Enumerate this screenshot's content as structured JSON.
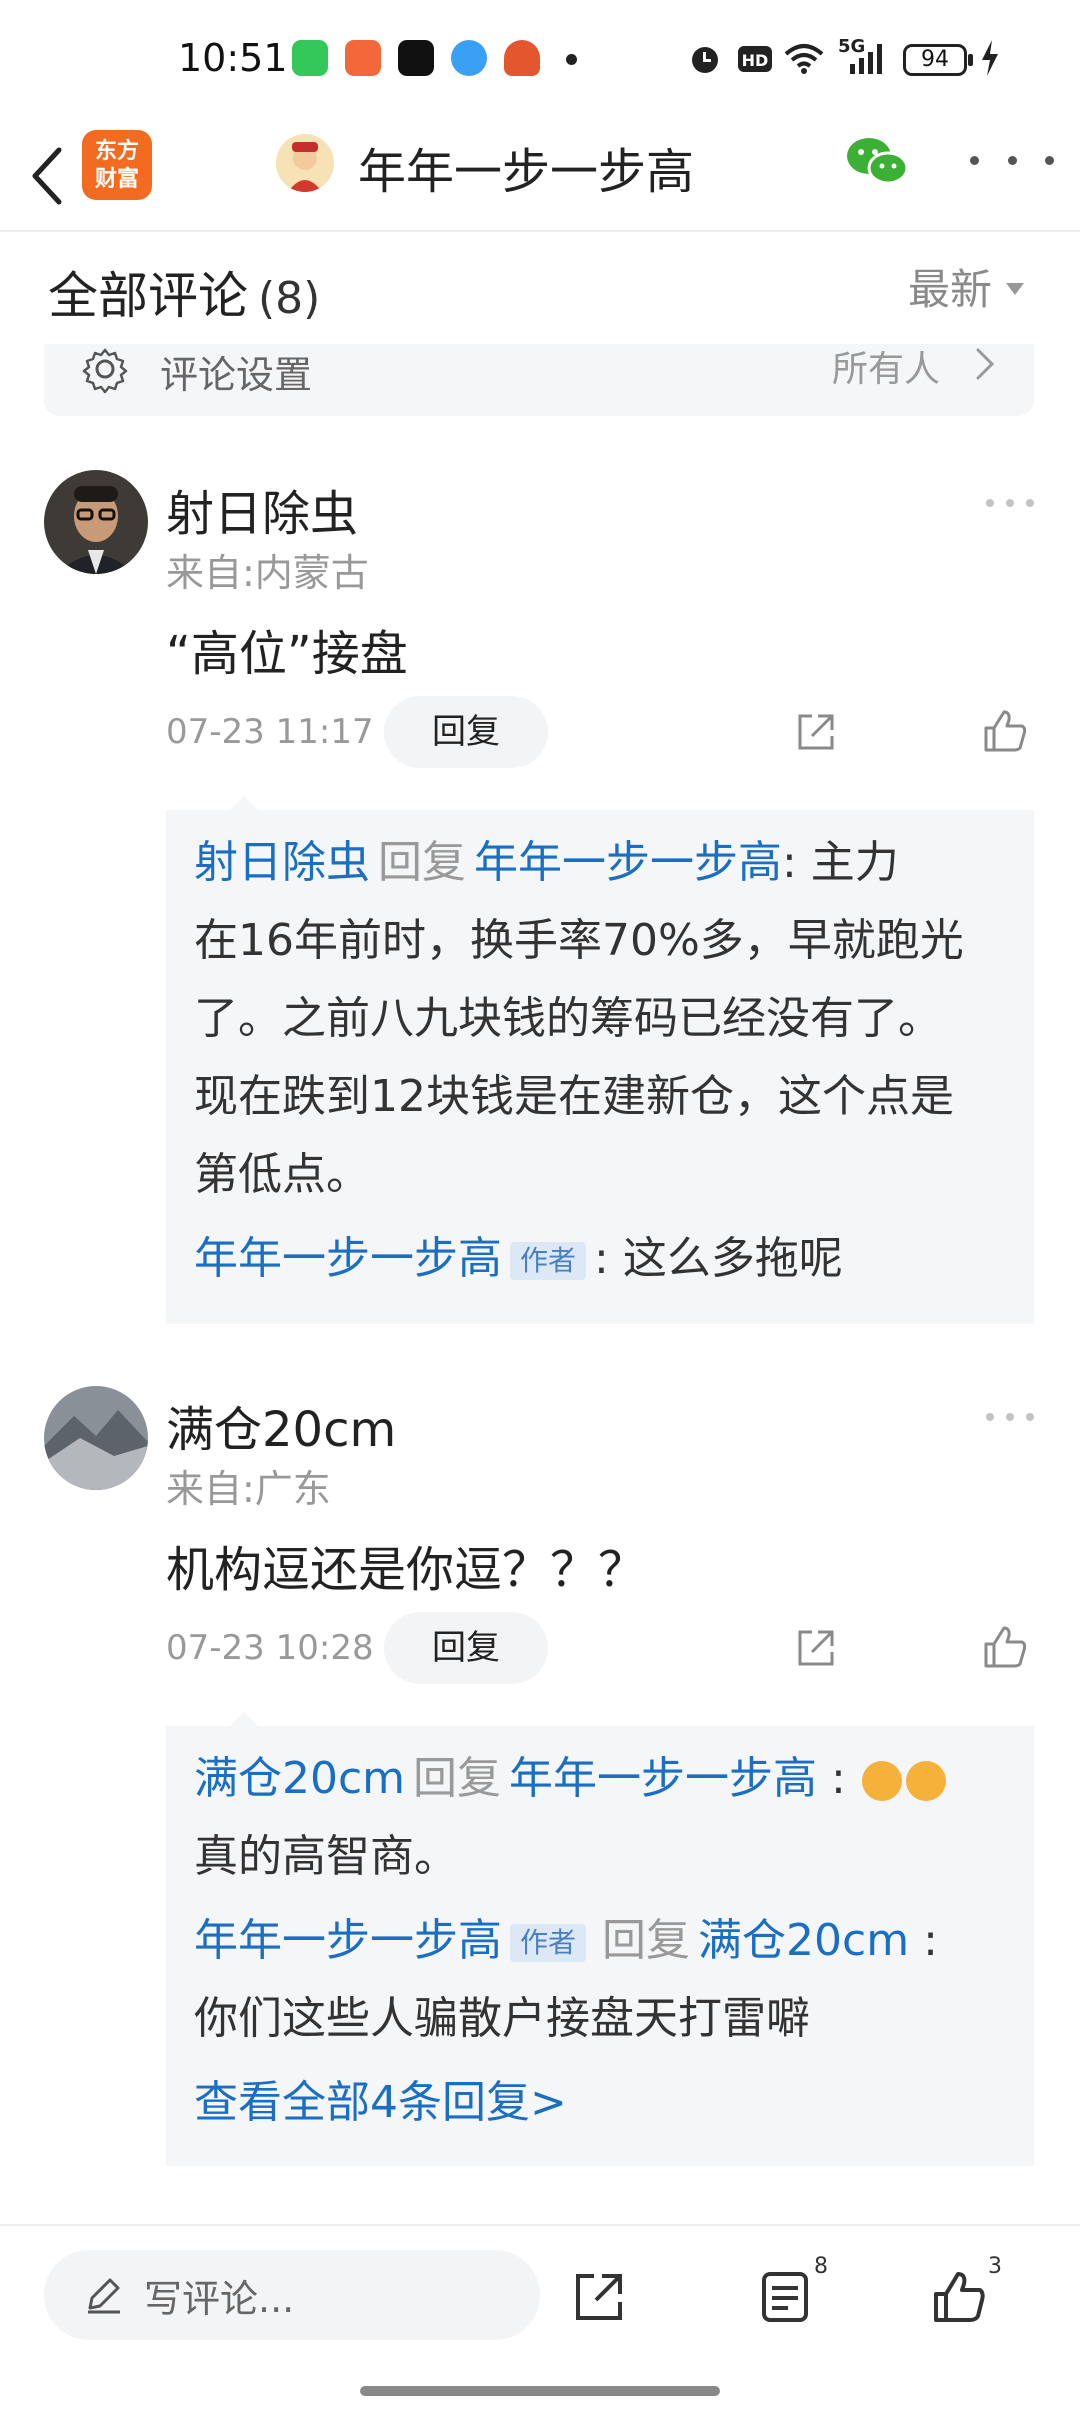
{
  "status_bar": {
    "time": "10:51",
    "network": "5G",
    "battery": "94"
  },
  "header": {
    "brand_line1": "东方",
    "brand_line2": "财富",
    "title": "年年一步一步高",
    "icons": [
      "back-icon",
      "wechat-icon",
      "more-icon"
    ]
  },
  "comments_header": {
    "title": "全部评论",
    "count": "(8)",
    "sort_label": "最新"
  },
  "settings": {
    "label": "评论设置",
    "value": "所有人"
  },
  "comments": [
    {
      "author": "射日除虫",
      "location": "来自:内蒙古",
      "text": "“高位”接盘",
      "time": "07-23 11:17",
      "reply_button": "回复",
      "replies": [
        {
          "from": "射日除虫",
          "verb": "回复",
          "to": "年年一步一步高",
          "text_lines": [
            ": 主力",
            "在16年前时，换手率70%多，早就跑光",
            "了。之前八九块钱的筹码已经没有了。",
            "现在跌到12块钱是在建新仓，这个点是",
            "第低点。"
          ]
        },
        {
          "from": "年年一步一步高",
          "tag": "作者",
          "text": ": 这么多拖呢"
        }
      ]
    },
    {
      "author": "满仓20cm",
      "location": "来自:广东",
      "text": "机构逗还是你逗？？？",
      "time": "07-23 10:28",
      "reply_button": "回复",
      "replies": [
        {
          "from": "满仓20cm",
          "verb": "回复",
          "to": "年年一步一步高",
          "colon": ":",
          "text": "真的高智商。"
        },
        {
          "from": "年年一步一步高",
          "tag": "作者",
          "verb": "回复",
          "to": "满仓20cm",
          "colon": ":",
          "text": "你们这些人骗散户接盘天打雷噼"
        }
      ],
      "view_all": "查看全部4条回复>"
    }
  ],
  "bottom_bar": {
    "placeholder": "写评论...",
    "comment_count": "8",
    "like_count": "3"
  }
}
